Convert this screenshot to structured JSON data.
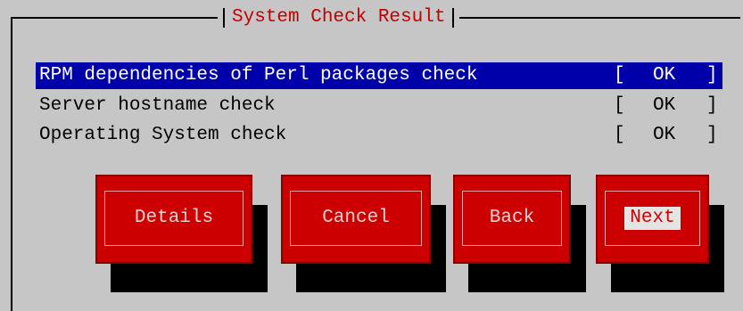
{
  "dialog": {
    "title": "System Check Result"
  },
  "checks": [
    {
      "name": "RPM dependencies of Perl packages check",
      "open": "[",
      "status": "OK",
      "close": "]"
    },
    {
      "name": "Server hostname check",
      "open": "[",
      "status": "OK",
      "close": "]"
    },
    {
      "name": "Operating System check",
      "open": "[",
      "status": "OK",
      "close": "]"
    }
  ],
  "buttons": {
    "details": "Details",
    "cancel": "Cancel",
    "back": "Back",
    "next": "Next"
  },
  "colors": {
    "background": "#c6c6c6",
    "title": "#c00000",
    "selection": "#0000aa",
    "button": "#cc0000",
    "shadow": "#000000"
  }
}
